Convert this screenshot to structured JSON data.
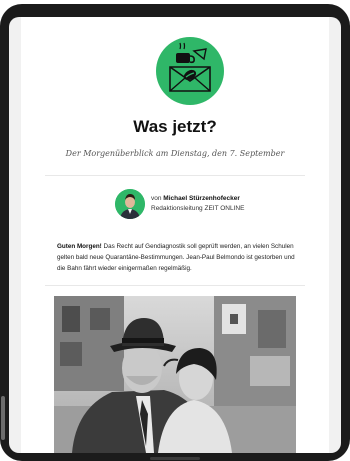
{
  "newsletter": {
    "title": "Was jetzt?",
    "subtitle": "Der Morgenüberblick am Dienstag, den 7. September",
    "logo_icon": "envelope-coffee-icon",
    "brand_green": "#2fb768"
  },
  "author": {
    "prefix": "von",
    "name": "Michael Stürzenhofecker",
    "role": "Redaktionsleitung ZEIT ONLINE"
  },
  "intro": {
    "greeting": "Guten Morgen!",
    "text": " Das Recht auf Gendiagnostik soll geprüft werden, an vielen Schulen gelten bald neue Quarantäne-Bestimmungen. Jean-Paul Belmondo ist gestorben und die Bahn fährt wieder einigermaßen regelmäßig."
  },
  "photo": {
    "subject": "black-and-white-film-still-photo"
  }
}
